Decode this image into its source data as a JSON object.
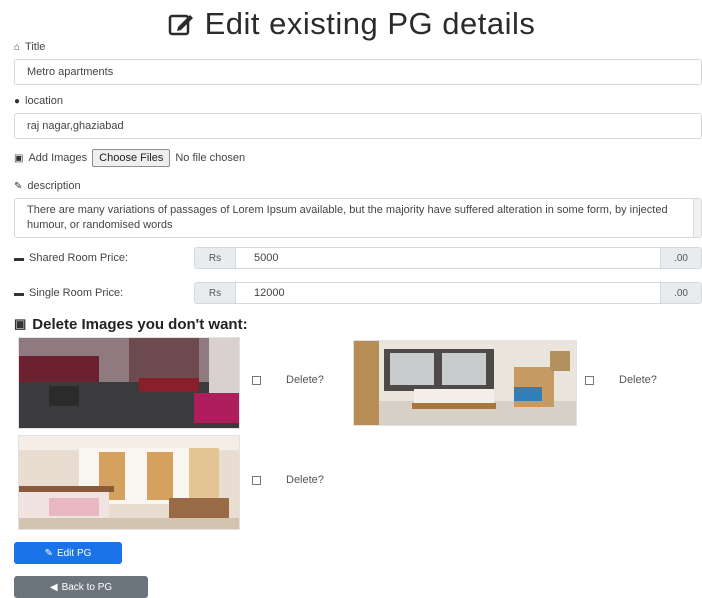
{
  "heading": {
    "icon": "edit-icon",
    "text": "Edit existing PG details"
  },
  "form": {
    "title": {
      "icon": "home-icon",
      "label": "Title",
      "value": "Metro apartments"
    },
    "location": {
      "icon": "map-marker-icon",
      "label": "location",
      "value": "raj nagar,ghaziabad"
    },
    "images": {
      "icon": "image-icon",
      "label": "Add Images",
      "button": "Choose Files",
      "status": "No file chosen"
    },
    "description": {
      "icon": "pen-icon",
      "label": "description",
      "value": "There are many variations of passages of Lorem Ipsum available, but the majority have suffered alteration in some form, by injected humour, or randomised words"
    },
    "shared_price": {
      "icon": "bed-icon",
      "label": "Shared Room Price:",
      "prefix": "Rs",
      "value": "5000",
      "suffix": ".00"
    },
    "single_price": {
      "icon": "bed-icon",
      "label": "Single Room Price:",
      "prefix": "Rs",
      "value": "12000",
      "suffix": ".00"
    }
  },
  "delete_section": {
    "icon": "image-icon",
    "title": "Delete Images you don't want:",
    "items": [
      {
        "label": "Delete?"
      },
      {
        "label": "Delete?"
      },
      {
        "label": "Delete?"
      }
    ]
  },
  "buttons": {
    "edit": {
      "icon": "edit-icon",
      "label": "Edit PG",
      "color": "#1a73e8"
    },
    "back": {
      "icon": "arrow-left-icon",
      "label": "Back to PG",
      "color": "#6c757d"
    }
  }
}
